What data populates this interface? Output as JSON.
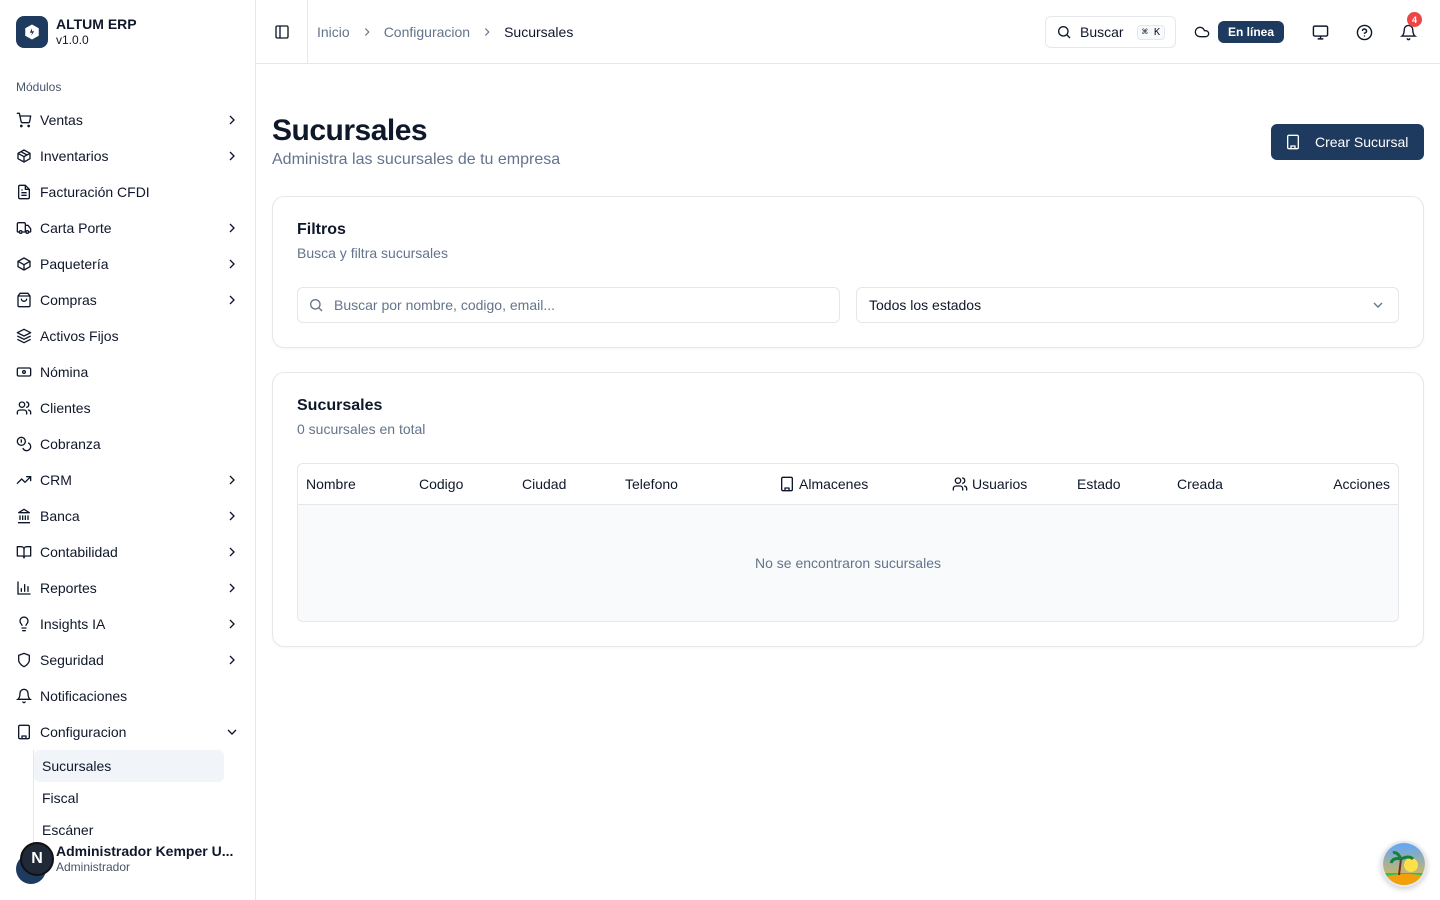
{
  "app": {
    "name": "ALTUM ERP",
    "version": "v1.0.0"
  },
  "sidebar": {
    "section_label": "Módulos",
    "items": [
      {
        "label": "Ventas",
        "icon": "cart-icon",
        "expandable": true
      },
      {
        "label": "Inventarios",
        "icon": "package-icon",
        "expandable": true
      },
      {
        "label": "Facturación CFDI",
        "icon": "document-icon",
        "expandable": false
      },
      {
        "label": "Carta Porte",
        "icon": "truck-icon",
        "expandable": true
      },
      {
        "label": "Paquetería",
        "icon": "box-icon",
        "expandable": true
      },
      {
        "label": "Compras",
        "icon": "shopping-bag-icon",
        "expandable": true
      },
      {
        "label": "Activos Fijos",
        "icon": "layers-icon",
        "expandable": false
      },
      {
        "label": "Nómina",
        "icon": "banknote-icon",
        "expandable": false
      },
      {
        "label": "Clientes",
        "icon": "users-icon",
        "expandable": false
      },
      {
        "label": "Cobranza",
        "icon": "coins-icon",
        "expandable": false
      },
      {
        "label": "CRM",
        "icon": "trending-icon",
        "expandable": true
      },
      {
        "label": "Banca",
        "icon": "bank-icon",
        "expandable": true
      },
      {
        "label": "Contabilidad",
        "icon": "book-icon",
        "expandable": true
      },
      {
        "label": "Reportes",
        "icon": "bar-chart-icon",
        "expandable": true
      },
      {
        "label": "Insights IA",
        "icon": "lightbulb-icon",
        "expandable": true
      },
      {
        "label": "Seguridad",
        "icon": "shield-icon",
        "expandable": true
      },
      {
        "label": "Notificaciones",
        "icon": "bell-icon",
        "expandable": false
      },
      {
        "label": "Configuracion",
        "icon": "building-icon",
        "expandable": true,
        "expanded": true
      }
    ],
    "sub_items": [
      {
        "label": "Sucursales",
        "active": true
      },
      {
        "label": "Fiscal",
        "active": false
      },
      {
        "label": "Escáner",
        "active": false
      }
    ],
    "user": {
      "initial": "N",
      "name": "Administrador Kemper U...",
      "role": "Administrador"
    }
  },
  "header": {
    "breadcrumb": [
      "Inicio",
      "Configuracion",
      "Sucursales"
    ],
    "search_label": "Buscar",
    "search_shortcut": "⌘ K",
    "status": "En línea",
    "notifications_count": "4"
  },
  "page": {
    "title": "Sucursales",
    "subtitle": "Administra las sucursales de tu empresa",
    "create_button": "Crear Sucursal"
  },
  "filters": {
    "title": "Filtros",
    "description": "Busca y filtra sucursales",
    "search_placeholder": "Buscar por nombre, codigo, email...",
    "status_select": "Todos los estados"
  },
  "table": {
    "title": "Sucursales",
    "count_text": "0 sucursales en total",
    "columns": [
      "Nombre",
      "Codigo",
      "Ciudad",
      "Telefono",
      "Almacenes",
      "Usuarios",
      "Estado",
      "Creada",
      "Acciones"
    ],
    "empty_text": "No se encontraron sucursales"
  },
  "colors": {
    "primary": "#1e3a5f",
    "badge": "#ef4444",
    "muted": "#64748b",
    "border": "#e5e7eb"
  }
}
